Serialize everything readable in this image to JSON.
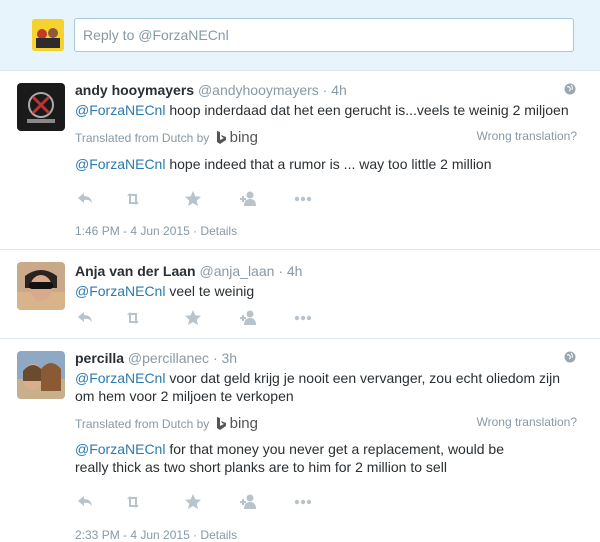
{
  "reply": {
    "placeholder": "Reply to @ForzaNECnl"
  },
  "tweets": [
    {
      "name": "andy hooymayers",
      "handle": "@andyhooymayers",
      "time": "· 4h",
      "mention": "@ForzaNECnl",
      "text": " hoop inderdaad dat het een gerucht is...veels te weinig 2 miljoen",
      "translated_label": "Translated from Dutch by",
      "bing_label": "bing",
      "wrong_label": "Wrong translation?",
      "translation_mention": "@ForzaNECnl",
      "translation": " hope indeed that a rumor is ... way too little 2 million",
      "footer": "1:46 PM - 4 Jun 2015 · Details"
    },
    {
      "name": "Anja van der Laan",
      "handle": "@anja_laan",
      "time": "· 4h",
      "mention": "@ForzaNECnl",
      "text": " veel te weinig"
    },
    {
      "name": "percilla",
      "handle": "@percillanec",
      "time": "· 3h",
      "mention": "@ForzaNECnl",
      "text": " voor dat geld krijg je nooit een vervanger, zou echt oliedom zijn om hem voor 2 miljoen te verkopen",
      "translated_label": "Translated from Dutch by",
      "bing_label": "bing",
      "wrong_label": "Wrong translation?",
      "translation_mention": "@ForzaNECnl",
      "translation": " for that money you never get a replacement, would be really thick as two short planks are to him for 2 million to sell",
      "footer": "2:33 PM - 4 Jun 2015 · Details"
    }
  ],
  "icons": [
    "reply-icon",
    "retweet-icon",
    "favorite-icon",
    "follow-icon",
    "more-icon",
    "globe-icon",
    "bing-icon"
  ],
  "colors": {
    "mention": "#2a7ab0",
    "muted": "#8899a6",
    "reply_bg": "#e8f4fb"
  }
}
